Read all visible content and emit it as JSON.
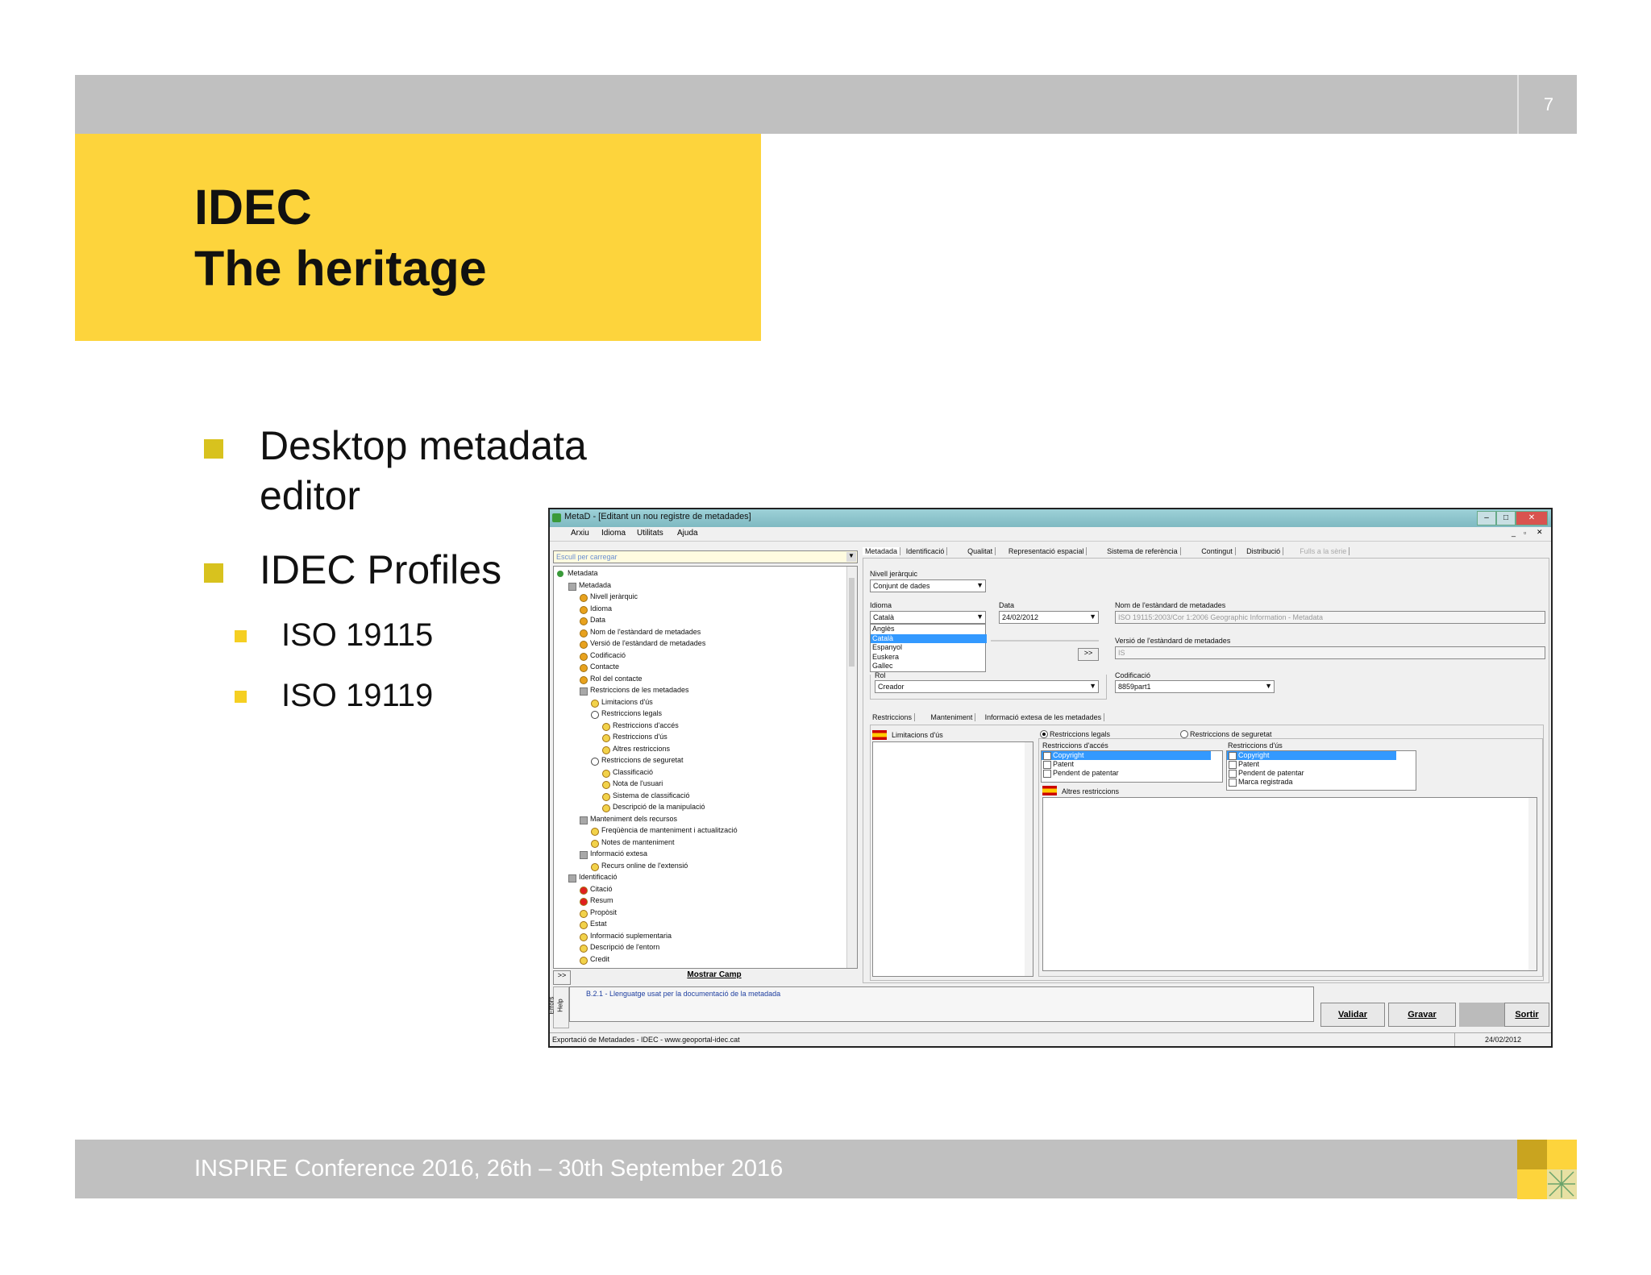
{
  "slide": {
    "page_number": "7",
    "title_line1": "IDEC",
    "title_line2": "The heritage",
    "bullets": [
      {
        "line1": "Desktop metadata",
        "line2": "editor"
      },
      {
        "line1": "IDEC Profiles"
      }
    ],
    "sub_bullets": [
      "ISO 19115",
      "ISO 19119"
    ],
    "footer": "INSPIRE Conference 2016, 26th – 30th September 2016"
  },
  "app": {
    "window_title": "MetaD - [Editant un nou registre de metadades]",
    "menu": [
      "Arxiu",
      "Idioma",
      "Utilitats",
      "Ajuda"
    ],
    "load_placeholder": "Escull per carregar",
    "tree": [
      {
        "label": "Metadata",
        "icon": "globe",
        "indent": 0
      },
      {
        "label": "Metadada",
        "icon": "folder",
        "indent": 1
      },
      {
        "label": "Nivell jeràrquic",
        "icon": "orange",
        "indent": 2
      },
      {
        "label": "Idioma",
        "icon": "orange",
        "indent": 2
      },
      {
        "label": "Data",
        "icon": "orange",
        "indent": 2
      },
      {
        "label": "Nom de l'estàndard de metadades",
        "icon": "orange",
        "indent": 2
      },
      {
        "label": "Versió de l'estàndard de metadades",
        "icon": "orange",
        "indent": 2
      },
      {
        "label": "Codificació",
        "icon": "orange",
        "indent": 2
      },
      {
        "label": "Contacte",
        "icon": "orange",
        "indent": 2
      },
      {
        "label": "Rol del contacte",
        "icon": "orange",
        "indent": 2
      },
      {
        "label": "Restriccions de les metadades",
        "icon": "folder",
        "indent": 2
      },
      {
        "label": "Limitacions d'ús",
        "icon": "yellow",
        "indent": 3
      },
      {
        "label": "Restriccions legals",
        "icon": "radio",
        "indent": 3
      },
      {
        "label": "Restriccions d'accés",
        "icon": "yellow",
        "indent": 4
      },
      {
        "label": "Restriccions d'ús",
        "icon": "yellow",
        "indent": 4
      },
      {
        "label": "Altres restriccions",
        "icon": "yellow",
        "indent": 4
      },
      {
        "label": "Restriccions de seguretat",
        "icon": "radio",
        "indent": 3
      },
      {
        "label": "Classificació",
        "icon": "yellow",
        "indent": 4
      },
      {
        "label": "Nota de l'usuari",
        "icon": "yellow",
        "indent": 4
      },
      {
        "label": "Sistema de classificació",
        "icon": "yellow",
        "indent": 4
      },
      {
        "label": "Descripció de la manipulació",
        "icon": "yellow",
        "indent": 4
      },
      {
        "label": "Manteniment dels recursos",
        "icon": "folder",
        "indent": 2
      },
      {
        "label": "Freqüència de manteniment i actualització",
        "icon": "yellow",
        "indent": 3
      },
      {
        "label": "Notes de manteniment",
        "icon": "yellow",
        "indent": 3
      },
      {
        "label": "Informació extesa",
        "icon": "folder",
        "indent": 2
      },
      {
        "label": "Recurs online de l'extensió",
        "icon": "yellow",
        "indent": 3
      },
      {
        "label": "Identificació",
        "icon": "folder",
        "indent": 1
      },
      {
        "label": "Citació",
        "icon": "red",
        "indent": 2
      },
      {
        "label": "Resum",
        "icon": "red",
        "indent": 2
      },
      {
        "label": "Propòsit",
        "icon": "yellow",
        "indent": 2
      },
      {
        "label": "Estat",
        "icon": "yellow",
        "indent": 2
      },
      {
        "label": "Informació suplementaria",
        "icon": "yellow",
        "indent": 2
      },
      {
        "label": "Descripció de l'entorn",
        "icon": "yellow",
        "indent": 2
      },
      {
        "label": "Credit",
        "icon": "yellow",
        "indent": 2
      }
    ],
    "show_field_label": "Mostrar Camp",
    "expand_label": ">>",
    "tabs": [
      "Metadada",
      "Identificació",
      "Qualitat",
      "Representació espacial",
      "Sistema de referència",
      "Contingut",
      "Distribució",
      "Fulls a la sèrie"
    ],
    "hier_level_label": "Nivell jeràrquic",
    "hier_level_value": "Conjunt de dades",
    "language_label": "Idioma",
    "language_value": "Català",
    "language_options": [
      "Anglès",
      "Català",
      "Espanyol",
      "Euskera",
      "Gallec"
    ],
    "date_label": "Data",
    "date_value": "24/02/2012",
    "std_name_label": "Nom de l'estàndard de metadades",
    "std_name_value": "ISO 19115:2003/Cor 1:2006 Geographic Information - Metadata",
    "std_version_label": "Versió de l'estàndard de metadades",
    "std_version_value": "IS",
    "role_label": "Rol",
    "role_value": "Creador",
    "encoding_label": "Codificació",
    "encoding_value": "8859part1",
    "contact_button": ">>",
    "subtabs": [
      "Restriccions",
      "Manteniment",
      "Informació extesa de les metadades"
    ],
    "use_limits_label": "Limitacions d'ús",
    "legal_radio": "Restriccions legals",
    "security_radio": "Restriccions de seguretat",
    "access_label": "Restriccions d'accés",
    "access_items": [
      "Copyright",
      "Patent",
      "Pendent de patentar"
    ],
    "use_label": "Restriccions d'ús",
    "use_items": [
      "Copyright",
      "Patent",
      "Pendent de patentar",
      "Marca registrada"
    ],
    "other_label": "Altres restriccions",
    "help_text": "B.2.1 - Llenguatge usat per la documentació de la metadada",
    "side_tabs": [
      "Errors",
      "Help"
    ],
    "validate": "Validar",
    "save": "Gravar",
    "exit": "Sortir",
    "status_left": "Exportació de Metadades - IDEC - www.geoportal-idec.cat",
    "status_right": "24/02/2012"
  },
  "colors": {
    "accent_yellow": "#fdd43c",
    "bar_grey": "#c0c0c0",
    "selection_blue": "#3399ff"
  }
}
